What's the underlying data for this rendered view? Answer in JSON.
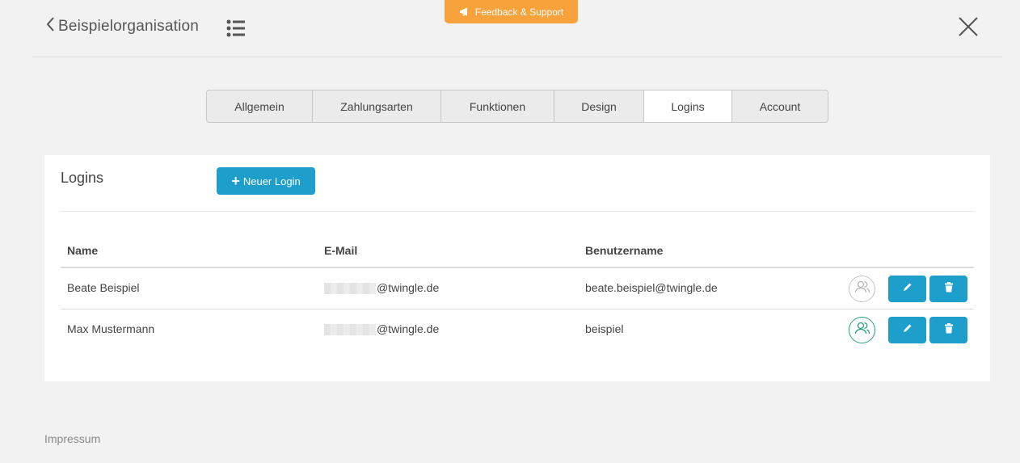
{
  "feedback": {
    "label": "Feedback & Support"
  },
  "header": {
    "title": "Beispielorganisation"
  },
  "tabs": [
    {
      "label": "Allgemein"
    },
    {
      "label": "Zahlungsarten"
    },
    {
      "label": "Funktionen"
    },
    {
      "label": "Design"
    },
    {
      "label": "Logins"
    },
    {
      "label": "Account"
    }
  ],
  "active_tab": "Logins",
  "card": {
    "title": "Logins",
    "new_login_label": "Neuer Login"
  },
  "table": {
    "headers": {
      "name": "Name",
      "email": "E-Mail",
      "username": "Benutzername"
    },
    "rows": [
      {
        "name": "Beate Beispiel",
        "email_domain": "@twingle.de",
        "username": "beate.beispiel@twingle.de",
        "admin": false
      },
      {
        "name": "Max Mustermann",
        "email_domain": "@twingle.de",
        "username": "beispiel",
        "admin": true
      }
    ]
  },
  "footer": {
    "impressum": "Impressum"
  },
  "colors": {
    "accent": "#1e9fcb",
    "feedback": "#f7a23b",
    "active_user": "#27a27a"
  },
  "icons": [
    "megaphone-icon",
    "chevron-left-icon",
    "list-icon",
    "close-icon",
    "plus-icon",
    "users-icon",
    "pencil-icon",
    "trash-icon"
  ]
}
